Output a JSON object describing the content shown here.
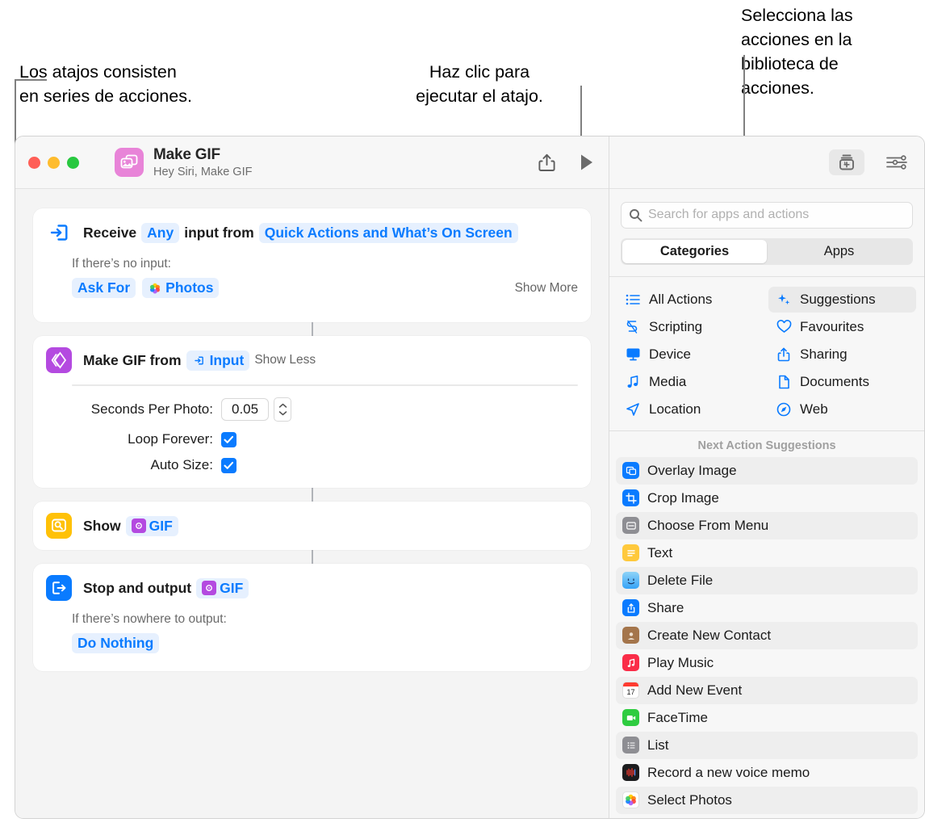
{
  "callouts": {
    "left": "Los atajos consisten\nen series de acciones.",
    "middle": "Haz clic para\nejecutar el atajo.",
    "right": "Selecciona las\nacciones en la\nbiblioteca de\nacciones."
  },
  "window": {
    "title": "Make GIF",
    "subtitle": "Hey Siri, Make GIF",
    "app_icon_name": "photos-stack-icon",
    "traffic_lights": [
      "close",
      "minimize",
      "zoom"
    ],
    "toolbar": {
      "share_label": "share-icon",
      "run_label": "play-icon",
      "library_label": "action-library-icon",
      "settings_label": "sliders-icon"
    }
  },
  "actions": [
    {
      "id": "receive-input",
      "icon_name": "receive-input-icon",
      "icon_color": "#0a7bff",
      "icon_style": "outline",
      "title_parts": [
        {
          "type": "text",
          "text": "Receive"
        },
        {
          "type": "token",
          "text": "Any"
        },
        {
          "type": "text",
          "text": "input from"
        },
        {
          "type": "token",
          "text": "Quick Actions and What’s On Screen"
        }
      ],
      "sub_label": "If there’s no input:",
      "sub_tokens": [
        {
          "text": "Ask For",
          "icon": null
        },
        {
          "text": "Photos",
          "icon": "photos-icon"
        }
      ],
      "toggle": "Show More"
    },
    {
      "id": "make-gif",
      "icon_name": "make-gif-icon",
      "icon_color": "#b44ae0",
      "title_parts": [
        {
          "type": "text",
          "text": "Make GIF from"
        },
        {
          "type": "token",
          "text": "Input",
          "icon": "input-icon"
        }
      ],
      "toggle": "Show Less",
      "params": [
        {
          "label": "Seconds Per Photo:",
          "type": "number",
          "value": "0.05"
        },
        {
          "label": "Loop Forever:",
          "type": "checkbox",
          "checked": true
        },
        {
          "label": "Auto Size:",
          "type": "checkbox",
          "checked": true
        }
      ]
    },
    {
      "id": "show",
      "icon_name": "quick-look-icon",
      "icon_color": "#ffc107",
      "title_parts": [
        {
          "type": "text",
          "text": "Show"
        },
        {
          "type": "token",
          "text": "GIF",
          "icon": "gif-variable-icon"
        }
      ]
    },
    {
      "id": "stop-and-output",
      "icon_name": "stop-output-icon",
      "icon_color": "#0a7bff",
      "title_parts": [
        {
          "type": "text",
          "text": "Stop and output"
        },
        {
          "type": "token",
          "text": "GIF",
          "icon": "gif-variable-icon"
        }
      ],
      "sub_label": "If there’s nowhere to output:",
      "sub_tokens": [
        {
          "text": "Do Nothing",
          "icon": null
        }
      ]
    }
  ],
  "library": {
    "search": {
      "placeholder": "Search for apps and actions",
      "value": ""
    },
    "tabs": [
      {
        "label": "Categories",
        "active": true
      },
      {
        "label": "Apps",
        "active": false
      }
    ],
    "categories": [
      {
        "label": "All Actions",
        "icon": "list-bullet-icon",
        "selected": false
      },
      {
        "label": "Suggestions",
        "icon": "sparkles-icon",
        "selected": true
      },
      {
        "label": "Scripting",
        "icon": "scripting-icon",
        "selected": false
      },
      {
        "label": "Favourites",
        "icon": "heart-icon",
        "selected": false
      },
      {
        "label": "Device",
        "icon": "display-icon",
        "selected": false
      },
      {
        "label": "Sharing",
        "icon": "share-icon",
        "selected": false
      },
      {
        "label": "Media",
        "icon": "music-note-icon",
        "selected": false
      },
      {
        "label": "Documents",
        "icon": "document-icon",
        "selected": false
      },
      {
        "label": "Location",
        "icon": "paper-plane-icon",
        "selected": false
      },
      {
        "label": "Web",
        "icon": "safari-icon",
        "selected": false
      }
    ],
    "suggestions_header": "Next Action Suggestions",
    "suggestions": [
      {
        "label": "Overlay Image",
        "icon": "overlay-image-icon",
        "color": "#0a7bff"
      },
      {
        "label": "Crop Image",
        "icon": "crop-image-icon",
        "color": "#0a7bff"
      },
      {
        "label": "Choose From Menu",
        "icon": "menu-icon",
        "color": "#8e8e93"
      },
      {
        "label": "Text",
        "icon": "text-icon",
        "color": "#ffc93c"
      },
      {
        "label": "Delete File",
        "icon": "finder-icon",
        "color": "#36a3f7"
      },
      {
        "label": "Share",
        "icon": "share-app-icon",
        "color": "#0a7bff"
      },
      {
        "label": "Create New Contact",
        "icon": "contacts-icon",
        "color": "#a4754b"
      },
      {
        "label": "Play Music",
        "icon": "music-app-icon",
        "color": "#fa2d48"
      },
      {
        "label": "Add New Event",
        "icon": "calendar-icon",
        "color": "#ffffff"
      },
      {
        "label": "FaceTime",
        "icon": "facetime-icon",
        "color": "#2ecc40"
      },
      {
        "label": "List",
        "icon": "list-icon",
        "color": "#8e8e93"
      },
      {
        "label": "Record a new voice memo",
        "icon": "voice-memos-icon",
        "color": "#1c1c1e"
      },
      {
        "label": "Select Photos",
        "icon": "photos-app-icon",
        "color": "#ffffff"
      }
    ]
  }
}
